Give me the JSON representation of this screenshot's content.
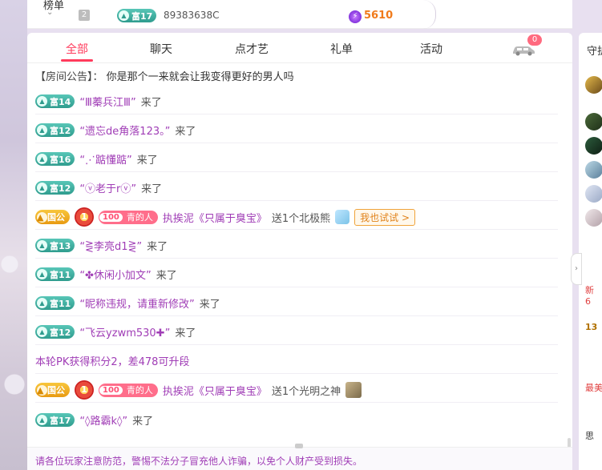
{
  "ranking": {
    "label": "榜单",
    "rank": "2",
    "badge": "富17",
    "user_id": "89383638C",
    "score": "5610"
  },
  "tabs": [
    {
      "label": "全部",
      "active": true
    },
    {
      "label": "聊天"
    },
    {
      "label": "点才艺"
    },
    {
      "label": "礼单"
    },
    {
      "label": "活动"
    }
  ],
  "car_count": "0",
  "notice": {
    "label": "【房间公告】：",
    "text": "你是那个一来就会让我变得更好的男人吗"
  },
  "messages": [
    {
      "type": "join",
      "badge": "富14",
      "name": "“Ⅲ蓁兵江Ⅲ”",
      "suffix": "来了"
    },
    {
      "type": "join",
      "badge": "富12",
      "name": "“遗忘de角落123。”",
      "suffix": "来了"
    },
    {
      "type": "join",
      "badge": "富16",
      "name": "“⋰踮懂踮”",
      "suffix": "来了"
    },
    {
      "type": "join",
      "badge": "富12",
      "name": "“ⓥ老于rⓥ”",
      "suffix": "来了"
    },
    {
      "type": "gift",
      "badge": "国公",
      "medal": "1",
      "level": "100",
      "level_text": "青的人",
      "sender": "执挨泥《只属于臭宝》",
      "action": "送1个北极熊",
      "try_label": "我也试试 >"
    },
    {
      "type": "join",
      "badge": "富13",
      "name": "“⋛李亮d1⋛”",
      "suffix": "来了"
    },
    {
      "type": "join",
      "badge": "富11",
      "name": "“✤休闲小加文”",
      "suffix": "来了"
    },
    {
      "type": "join",
      "badge": "富11",
      "name": "“昵称违规，请重新修改”",
      "suffix": "来了"
    },
    {
      "type": "join",
      "badge": "富12",
      "name": "“飞云yzwm530✚”",
      "suffix": "来了"
    },
    {
      "type": "pk",
      "text": "本轮PK获得积分2，差478可升段"
    },
    {
      "type": "gift",
      "badge": "国公",
      "medal": "1",
      "level": "100",
      "level_text": "青的人",
      "sender": "执挨泥《只属于臭宝》",
      "action": "送1个光明之神"
    },
    {
      "type": "join",
      "badge": "富17",
      "name": "“◊路霸k◊”",
      "suffix": "来了"
    }
  ],
  "footer": "请各位玩家注意防范，警惕不法分子冒充他人诈骗，以免个人财产受到损失。",
  "right": {
    "title": "守护",
    "partial_texts": [
      "新",
      "6",
      "13",
      "最美",
      "思"
    ]
  }
}
